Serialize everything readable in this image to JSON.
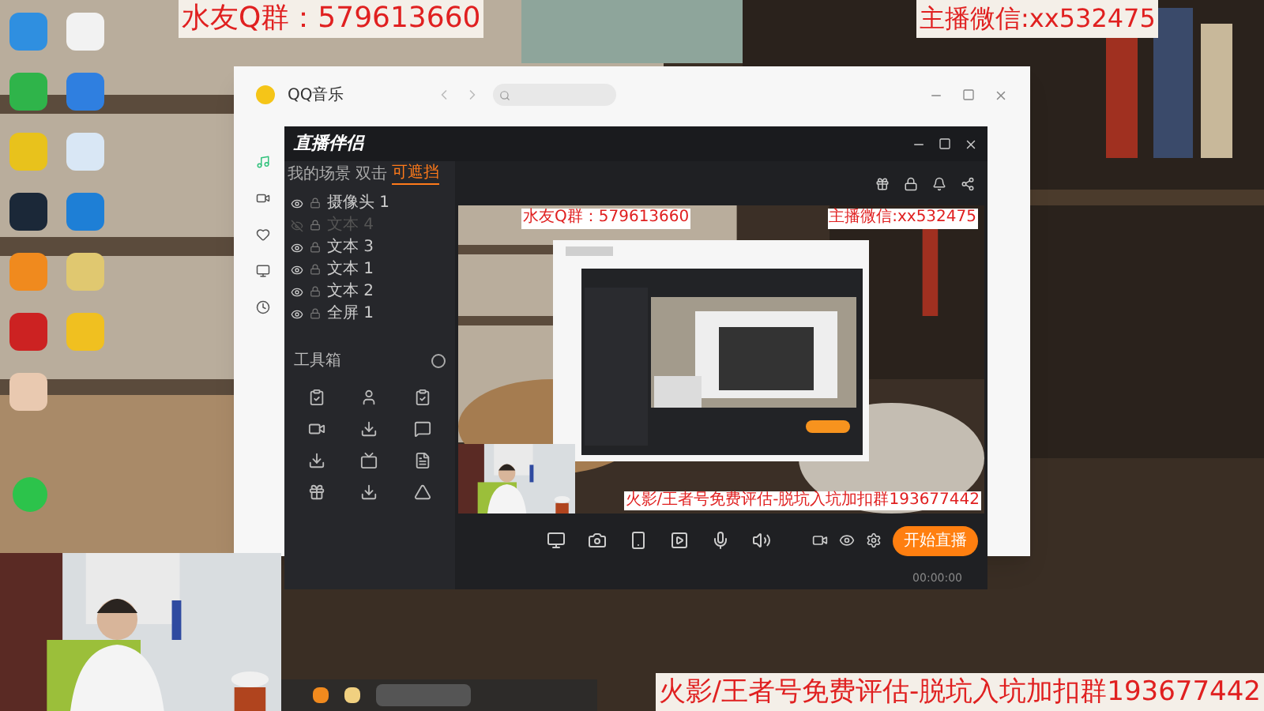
{
  "overlays": {
    "qq_group": "水友Q群：579613660",
    "wechat": "主播微信:xx532475",
    "promo": "火影/王者号免费评估-脱坑入坑加扣群193677442"
  },
  "music_window": {
    "title": "QQ音乐"
  },
  "stream_app": {
    "title": "直播伴侣",
    "scene_tabs": [
      {
        "label": "我的场景",
        "selected": false
      },
      {
        "label": "双击",
        "selected": false
      },
      {
        "label": "可遮挡",
        "selected": true
      }
    ],
    "layers": [
      {
        "label": "摄像头 1",
        "visible": true
      },
      {
        "label": "文本 4",
        "visible": false
      },
      {
        "label": "文本 3",
        "visible": true
      },
      {
        "label": "文本 1",
        "visible": true
      },
      {
        "label": "文本 2",
        "visible": true
      },
      {
        "label": "全屏 1",
        "visible": true
      }
    ],
    "toolbox_title": "工具箱",
    "preview": {
      "qq_group": "水友Q群：579613660",
      "wechat": "主播微信:xx532475",
      "promo": "火影/王者号免费评估-脱坑入坑加扣群193677442"
    },
    "start_button": "开始直播",
    "timer": "00:00:00"
  }
}
